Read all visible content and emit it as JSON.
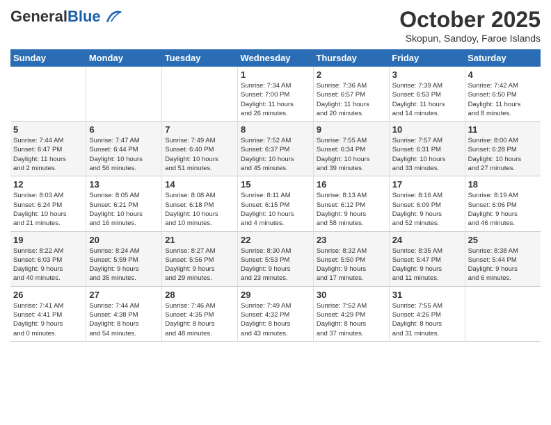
{
  "header": {
    "logo_general": "General",
    "logo_blue": "Blue",
    "month_title": "October 2025",
    "subtitle": "Skopun, Sandoy, Faroe Islands"
  },
  "days_of_week": [
    "Sunday",
    "Monday",
    "Tuesday",
    "Wednesday",
    "Thursday",
    "Friday",
    "Saturday"
  ],
  "weeks": [
    [
      {
        "day": "",
        "info": ""
      },
      {
        "day": "",
        "info": ""
      },
      {
        "day": "",
        "info": ""
      },
      {
        "day": "1",
        "info": "Sunrise: 7:34 AM\nSunset: 7:00 PM\nDaylight: 11 hours\nand 26 minutes."
      },
      {
        "day": "2",
        "info": "Sunrise: 7:36 AM\nSunset: 6:57 PM\nDaylight: 11 hours\nand 20 minutes."
      },
      {
        "day": "3",
        "info": "Sunrise: 7:39 AM\nSunset: 6:53 PM\nDaylight: 11 hours\nand 14 minutes."
      },
      {
        "day": "4",
        "info": "Sunrise: 7:42 AM\nSunset: 6:50 PM\nDaylight: 11 hours\nand 8 minutes."
      }
    ],
    [
      {
        "day": "5",
        "info": "Sunrise: 7:44 AM\nSunset: 6:47 PM\nDaylight: 11 hours\nand 2 minutes."
      },
      {
        "day": "6",
        "info": "Sunrise: 7:47 AM\nSunset: 6:44 PM\nDaylight: 10 hours\nand 56 minutes."
      },
      {
        "day": "7",
        "info": "Sunrise: 7:49 AM\nSunset: 6:40 PM\nDaylight: 10 hours\nand 51 minutes."
      },
      {
        "day": "8",
        "info": "Sunrise: 7:52 AM\nSunset: 6:37 PM\nDaylight: 10 hours\nand 45 minutes."
      },
      {
        "day": "9",
        "info": "Sunrise: 7:55 AM\nSunset: 6:34 PM\nDaylight: 10 hours\nand 39 minutes."
      },
      {
        "day": "10",
        "info": "Sunrise: 7:57 AM\nSunset: 6:31 PM\nDaylight: 10 hours\nand 33 minutes."
      },
      {
        "day": "11",
        "info": "Sunrise: 8:00 AM\nSunset: 6:28 PM\nDaylight: 10 hours\nand 27 minutes."
      }
    ],
    [
      {
        "day": "12",
        "info": "Sunrise: 8:03 AM\nSunset: 6:24 PM\nDaylight: 10 hours\nand 21 minutes."
      },
      {
        "day": "13",
        "info": "Sunrise: 8:05 AM\nSunset: 6:21 PM\nDaylight: 10 hours\nand 16 minutes."
      },
      {
        "day": "14",
        "info": "Sunrise: 8:08 AM\nSunset: 6:18 PM\nDaylight: 10 hours\nand 10 minutes."
      },
      {
        "day": "15",
        "info": "Sunrise: 8:11 AM\nSunset: 6:15 PM\nDaylight: 10 hours\nand 4 minutes."
      },
      {
        "day": "16",
        "info": "Sunrise: 8:13 AM\nSunset: 6:12 PM\nDaylight: 9 hours\nand 58 minutes."
      },
      {
        "day": "17",
        "info": "Sunrise: 8:16 AM\nSunset: 6:09 PM\nDaylight: 9 hours\nand 52 minutes."
      },
      {
        "day": "18",
        "info": "Sunrise: 8:19 AM\nSunset: 6:06 PM\nDaylight: 9 hours\nand 46 minutes."
      }
    ],
    [
      {
        "day": "19",
        "info": "Sunrise: 8:22 AM\nSunset: 6:03 PM\nDaylight: 9 hours\nand 40 minutes."
      },
      {
        "day": "20",
        "info": "Sunrise: 8:24 AM\nSunset: 5:59 PM\nDaylight: 9 hours\nand 35 minutes."
      },
      {
        "day": "21",
        "info": "Sunrise: 8:27 AM\nSunset: 5:56 PM\nDaylight: 9 hours\nand 29 minutes."
      },
      {
        "day": "22",
        "info": "Sunrise: 8:30 AM\nSunset: 5:53 PM\nDaylight: 9 hours\nand 23 minutes."
      },
      {
        "day": "23",
        "info": "Sunrise: 8:32 AM\nSunset: 5:50 PM\nDaylight: 9 hours\nand 17 minutes."
      },
      {
        "day": "24",
        "info": "Sunrise: 8:35 AM\nSunset: 5:47 PM\nDaylight: 9 hours\nand 11 minutes."
      },
      {
        "day": "25",
        "info": "Sunrise: 8:38 AM\nSunset: 5:44 PM\nDaylight: 9 hours\nand 6 minutes."
      }
    ],
    [
      {
        "day": "26",
        "info": "Sunrise: 7:41 AM\nSunset: 4:41 PM\nDaylight: 9 hours\nand 0 minutes."
      },
      {
        "day": "27",
        "info": "Sunrise: 7:44 AM\nSunset: 4:38 PM\nDaylight: 8 hours\nand 54 minutes."
      },
      {
        "day": "28",
        "info": "Sunrise: 7:46 AM\nSunset: 4:35 PM\nDaylight: 8 hours\nand 48 minutes."
      },
      {
        "day": "29",
        "info": "Sunrise: 7:49 AM\nSunset: 4:32 PM\nDaylight: 8 hours\nand 43 minutes."
      },
      {
        "day": "30",
        "info": "Sunrise: 7:52 AM\nSunset: 4:29 PM\nDaylight: 8 hours\nand 37 minutes."
      },
      {
        "day": "31",
        "info": "Sunrise: 7:55 AM\nSunset: 4:26 PM\nDaylight: 8 hours\nand 31 minutes."
      },
      {
        "day": "",
        "info": ""
      }
    ]
  ]
}
